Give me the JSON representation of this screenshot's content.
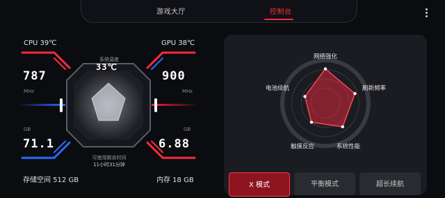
{
  "tabs": {
    "lobby": "游戏大厅",
    "console": "控制台"
  },
  "left": {
    "cpu_temp": "CPU  39℃",
    "gpu_temp": "GPU  38℃",
    "system_temp_label": "系统温度",
    "system_temp_value": "33℃",
    "cpu_freq": "787",
    "gpu_freq": "900",
    "mhz_unit_left": "MHz",
    "mhz_unit_right": "MHz",
    "gb_unit_left": "GB",
    "gb_unit_right": "GB",
    "storage_used": "71.1",
    "memory_used": "6.88",
    "remaining_time_label": "可使用剩余时间",
    "remaining_time_value": "11小时31分钟",
    "storage_total": "存储空间  512 GB",
    "memory_total": "内存  18 GB"
  },
  "radar": {
    "labels": {
      "network": "网络强化",
      "refresh": "刷新频率",
      "performance": "系统性能",
      "touch": "触摸反应",
      "battery": "电池续航"
    },
    "levels": {
      "network": 0.8,
      "refresh": 0.72,
      "performance": 0.68,
      "touch": 0.55,
      "battery": 0.5
    },
    "colors": {
      "fill": "#ff2b3e",
      "accent": "#ff2a3d"
    }
  },
  "modes": {
    "x_mode": "X 模式",
    "balanced": "平衡模式",
    "long_battery": "超长续航"
  },
  "icons": {
    "menu": "more-vertical-icon"
  }
}
